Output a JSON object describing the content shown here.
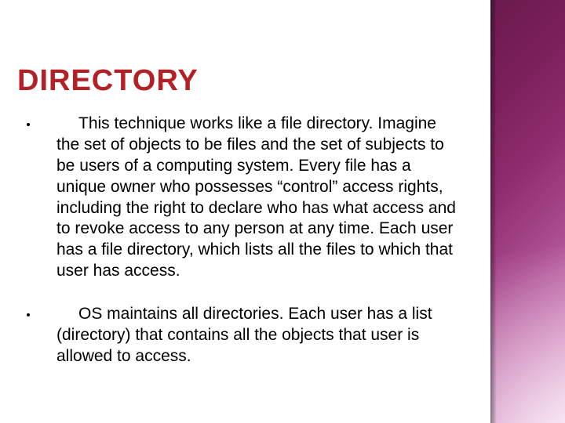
{
  "slide": {
    "title": "DIRECTORY",
    "bullets": [
      "This technique works like a file directory. Imagine the set of objects to be files and the set of subjects to be users of a computing system. Every file has a unique owner who possesses “control” access rights, including the right to declare who has what access and to revoke access to any person at any time. Each user has a file directory, which lists all the files to which that user has access.",
      "OS maintains all directories. Each user has a list (directory) that contains all the objects that user is allowed to access."
    ]
  }
}
